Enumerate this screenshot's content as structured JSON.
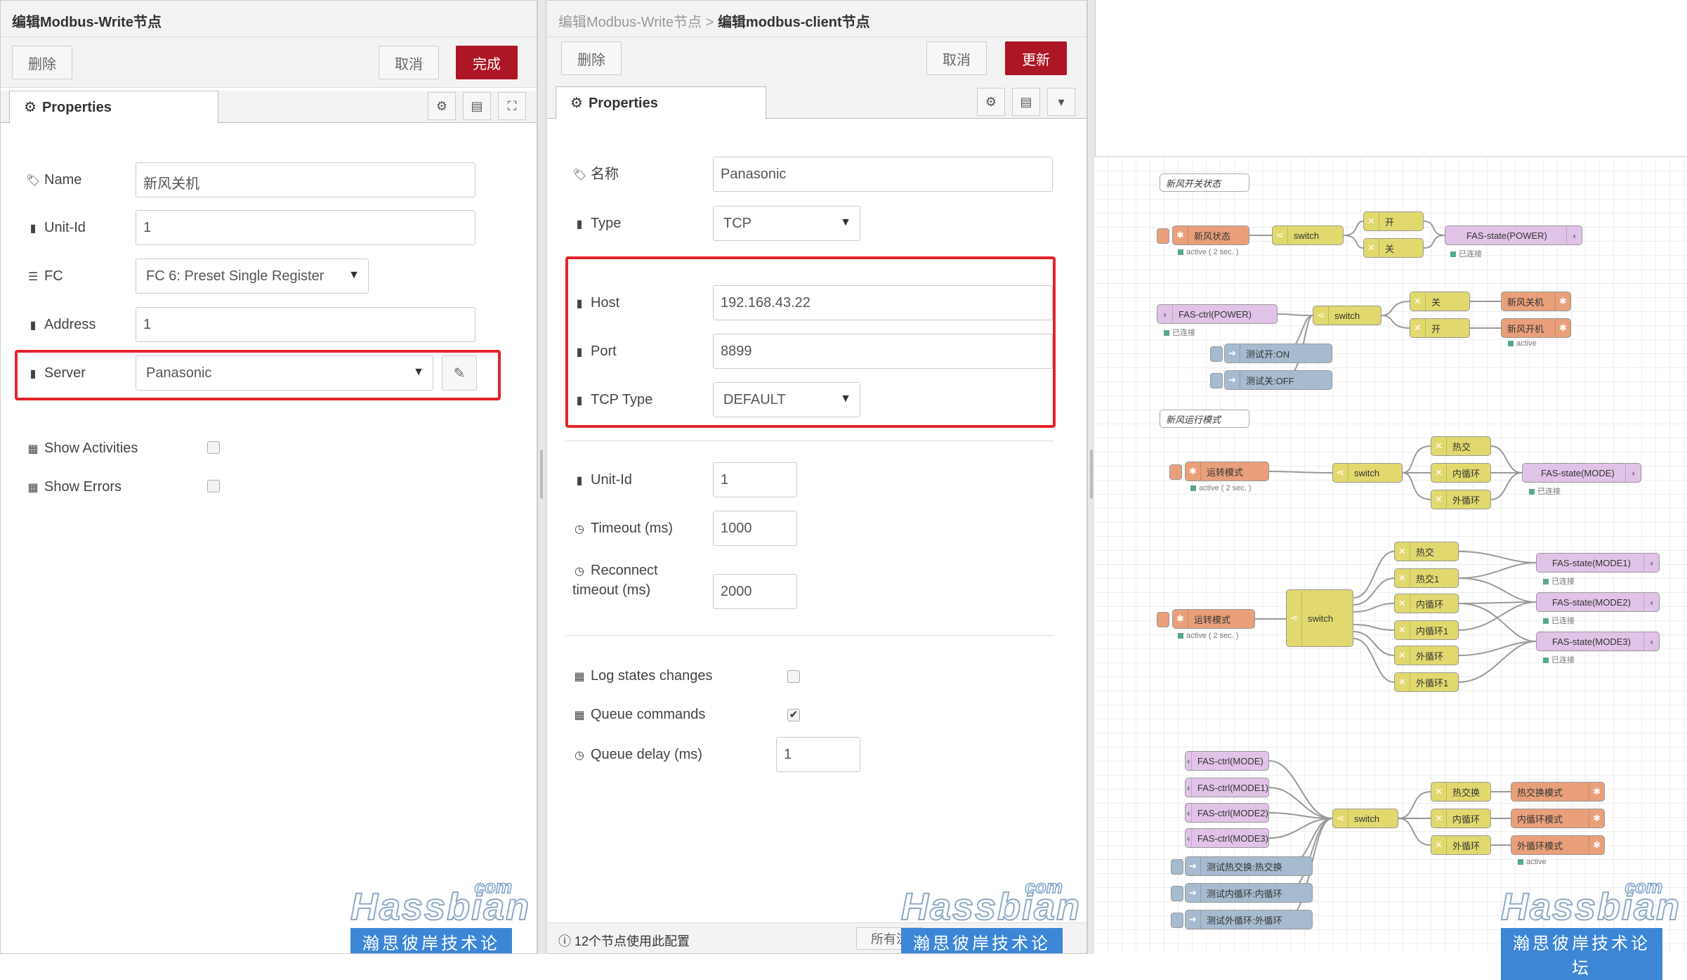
{
  "panel1": {
    "title": "编辑Modbus-Write节点",
    "buttons": {
      "delete": "删除",
      "cancel": "取消",
      "done": "完成"
    },
    "tab": "Properties",
    "fields": {
      "name": {
        "label": "Name",
        "value": "新风关机"
      },
      "unit_id": {
        "label": "Unit-Id",
        "value": "1"
      },
      "fc": {
        "label": "FC",
        "value": "FC 6: Preset Single Register"
      },
      "address": {
        "label": "Address",
        "value": "1"
      },
      "server": {
        "label": "Server",
        "value": "Panasonic"
      }
    },
    "checkboxes": {
      "show_activities": {
        "label": "Show Activities",
        "checked": false
      },
      "show_errors": {
        "label": "Show Errors",
        "checked": false
      }
    }
  },
  "panel2": {
    "breadcrumb_parent": "编辑Modbus-Write节点",
    "breadcrumb_sep": ">",
    "title": "编辑modbus-client节点",
    "buttons": {
      "delete": "删除",
      "cancel": "取消",
      "update": "更新"
    },
    "tab": "Properties",
    "fields": {
      "name": {
        "label": "名称",
        "value": "Panasonic"
      },
      "type": {
        "label": "Type",
        "value": "TCP"
      },
      "host": {
        "label": "Host",
        "value": "192.168.43.22"
      },
      "port": {
        "label": "Port",
        "value": "8899"
      },
      "tcp_type": {
        "label": "TCP Type",
        "value": "DEFAULT"
      },
      "unit_id": {
        "label": "Unit-Id",
        "value": "1"
      },
      "timeout": {
        "label": "Timeout (ms)",
        "value": "1000"
      },
      "reconnect_l1": "Reconnect",
      "reconnect_l2": "timeout (ms)",
      "reconnect_value": "2000",
      "queue_delay": {
        "label": "Queue delay (ms)",
        "value": "1"
      }
    },
    "checkboxes": {
      "log_states": {
        "label": "Log states changes",
        "checked": false
      },
      "queue_commands": {
        "label": "Queue commands",
        "checked": true
      }
    },
    "footer": "12个节点使用此配置",
    "footer_scope": "所有流"
  },
  "watermark": {
    "com": "com",
    "brand": "Hassbian",
    "cn": "瀚思彼岸技术论坛"
  },
  "flow": {
    "comments": [
      "新风开关状态",
      "新风运行模式"
    ],
    "nodes": {
      "n1": "新风状态",
      "n2": "switch",
      "n3": "开",
      "n4": "关",
      "n5": "FAS-state(POWER)",
      "n6": "FAS-ctrl(POWER)",
      "n7": "switch",
      "n8": "关",
      "n9": "开",
      "n10": "新风关机",
      "n11": "新风开机",
      "n12": "测试开:ON",
      "n13": "测试关:OFF",
      "n14": "运转模式",
      "n15": "switch",
      "n16": "热交",
      "n17": "内循环",
      "n18": "外循环",
      "n19": "FAS-state(MODE)",
      "n20": "运转模式",
      "n21": "switch",
      "n22": "热交",
      "n23": "热交1",
      "n24": "内循环",
      "n25": "内循环1",
      "n26": "外循环",
      "n27": "外循环1",
      "n28": "FAS-state(MODE1)",
      "n29": "FAS-state(MODE2)",
      "n30": "FAS-state(MODE3)",
      "n31": "FAS-ctrl(MODE)",
      "n32": "FAS-ctrl(MODE1)",
      "n33": "FAS-ctrl(MODE2)",
      "n34": "FAS-ctrl(MODE3)",
      "n35": "测试热交换:热交换",
      "n36": "测试内循环:内循环",
      "n37": "测试外循环:外循环",
      "n38": "switch",
      "n39": "热交换",
      "n40": "内循环",
      "n41": "外循环",
      "n42": "热交换模式",
      "n43": "内循环模式",
      "n44": "外循环模式"
    },
    "status": {
      "active": "active",
      "active2": "active ( 2 sec. )",
      "connected": "已连接"
    }
  },
  "colors": {
    "primary": "#ad1625",
    "highlight": "#e5232b",
    "inject": "#e9a07a",
    "function": "#e2d96e",
    "modbus": "#e2c3e8",
    "debug": "#a6bbcf"
  }
}
